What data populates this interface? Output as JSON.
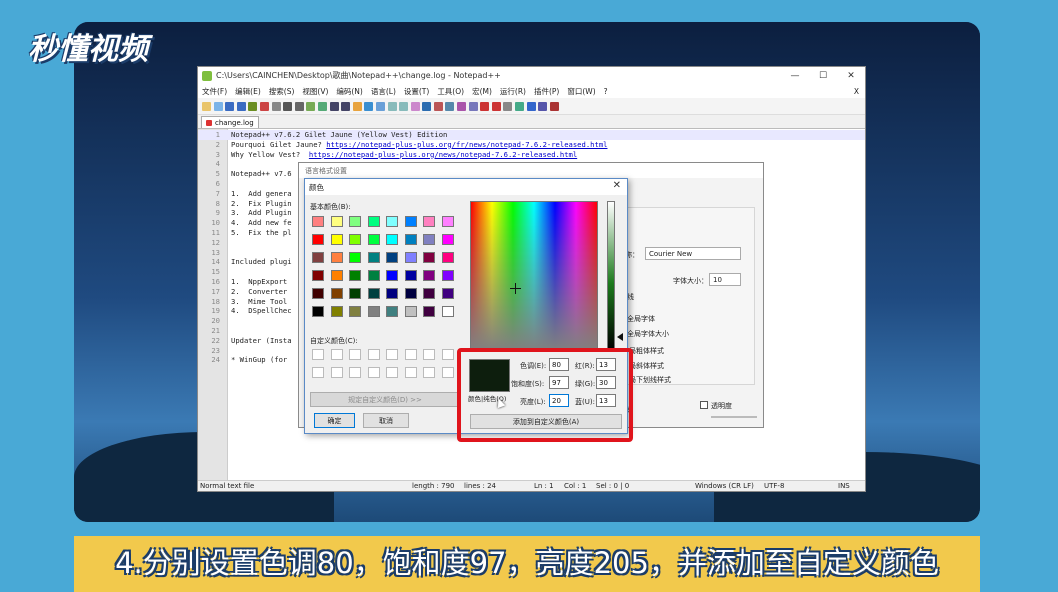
{
  "logo": "秒懂视频",
  "caption": "4.分别设置色调80，饱和度97，亮度205，并添加至自定义颜色",
  "npp": {
    "title": "C:\\Users\\CAINCHEN\\Desktop\\歌曲\\Notepad++\\change.log - Notepad++",
    "window_buttons": {
      "minimize": "—",
      "maximize": "☐",
      "close": "✕"
    },
    "menu": [
      "文件(F)",
      "编辑(E)",
      "搜索(S)",
      "视图(V)",
      "编码(N)",
      "语言(L)",
      "设置(T)",
      "工具(O)",
      "宏(M)",
      "运行(R)",
      "插件(P)",
      "窗口(W)",
      "?"
    ],
    "menu_close": "X",
    "tab_label": "change.log",
    "lines": [
      {
        "n": "1",
        "t": "Notepad++ v7.6.2 Gilet Jaune (Yellow Vest) Edition",
        "hl": true
      },
      {
        "n": "2",
        "t": "Pourquoi Gilet Jaune? ",
        "link": "https://notepad-plus-plus.org/fr/news/notepad-7.6.2-released.html"
      },
      {
        "n": "3",
        "t": "Why Yellow Vest?  ",
        "link": "https://notepad-plus-plus.org/news/notepad-7.6.2-released.html"
      },
      {
        "n": "4",
        "t": ""
      },
      {
        "n": "5",
        "t": "Notepad++ v7.6"
      },
      {
        "n": "6",
        "t": ""
      },
      {
        "n": "7",
        "t": "1.  Add genera"
      },
      {
        "n": "8",
        "t": "2.  Fix Plugin"
      },
      {
        "n": "9",
        "t": "3.  Add Plugin"
      },
      {
        "n": "10",
        "t": "4.  Add new fe"
      },
      {
        "n": "11",
        "t": "5.  Fix the pl"
      },
      {
        "n": "12",
        "t": ""
      },
      {
        "n": "13",
        "t": ""
      },
      {
        "n": "14",
        "t": "Included plugi"
      },
      {
        "n": "15",
        "t": ""
      },
      {
        "n": "16",
        "t": "1.  NppExport"
      },
      {
        "n": "17",
        "t": "2.  Converter"
      },
      {
        "n": "18",
        "t": "3.  Mime Tool"
      },
      {
        "n": "19",
        "t": "4.  DSpellChec"
      },
      {
        "n": "20",
        "t": ""
      },
      {
        "n": "21",
        "t": ""
      },
      {
        "n": "22",
        "t": "Updater (Insta"
      },
      {
        "n": "23",
        "t": ""
      },
      {
        "n": "24",
        "t": "* WinGup (for"
      }
    ],
    "status": {
      "type": "Normal text file",
      "length": "length : 790",
      "lines": "lines : 24",
      "ln": "Ln : 1",
      "col": "Col : 1",
      "sel": "Sel : 0 | 0",
      "eol": "Windows (CR LF)",
      "enc": "UTF-8",
      "mode": "INS"
    }
  },
  "style_dialog": {
    "title": "语言格式设置",
    "font_name_label": "称：",
    "font_name_value": "Courier New",
    "font_size_label": "字体大小：",
    "font_size_value": "10",
    "line_label": "线",
    "options": [
      "全局字体",
      "全局字体大小",
      "局粗体样式",
      "局斜体样式",
      "局下划线样式"
    ],
    "transparency_label": "透明度",
    "partial_button": "消"
  },
  "color_dialog": {
    "title": "颜色",
    "close": "✕",
    "basic_label": "基本颜色(B):",
    "custom_label": "自定义颜色(C):",
    "define_button": "规定自定义颜色(D) >>",
    "ok_button": "确定",
    "cancel_button": "取消",
    "color_solid_label": "颜色|纯色(O)",
    "hue_label": "色调(E):",
    "sat_label": "饱和度(S):",
    "lum_label": "亮度(L):",
    "red_label": "红(R):",
    "green_label": "绿(G):",
    "blue_label": "蓝(U):",
    "hue": "80",
    "sat": "97",
    "lum": "20",
    "red": "13",
    "green": "30",
    "blue": "13",
    "add_button": "添加到自定义颜色(A)",
    "preview_color": "#0d1e0d",
    "basic_colors": [
      "#ff8080",
      "#ffff80",
      "#80ff80",
      "#00ff80",
      "#80ffff",
      "#0080ff",
      "#ff80c0",
      "#ff80ff",
      "#ff0000",
      "#ffff00",
      "#80ff00",
      "#00ff40",
      "#00ffff",
      "#0080c0",
      "#8080c0",
      "#ff00ff",
      "#804040",
      "#ff8040",
      "#00ff00",
      "#008080",
      "#004080",
      "#8080ff",
      "#800040",
      "#ff0080",
      "#800000",
      "#ff8000",
      "#008000",
      "#008040",
      "#0000ff",
      "#0000a0",
      "#800080",
      "#8000ff",
      "#400000",
      "#804000",
      "#004000",
      "#004040",
      "#000080",
      "#000040",
      "#400040",
      "#400080",
      "#000000",
      "#808000",
      "#808040",
      "#808080",
      "#408080",
      "#c0c0c0",
      "#400040",
      "#ffffff"
    ]
  }
}
